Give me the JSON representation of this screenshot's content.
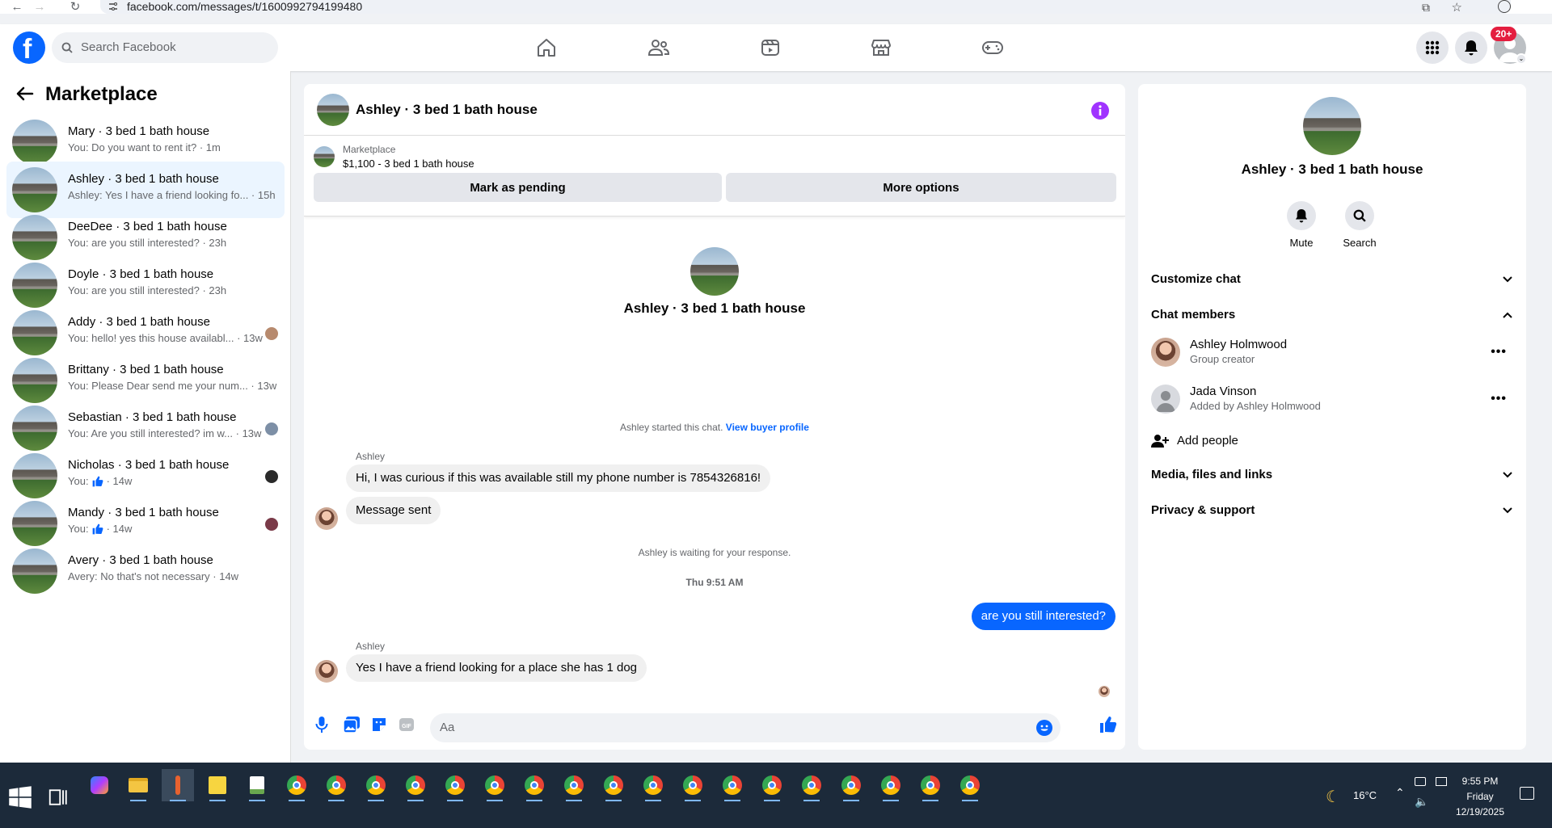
{
  "browser": {
    "url": "facebook.com/messages/t/1600992794199480"
  },
  "header": {
    "search_placeholder": "Search Facebook",
    "notifications_badge": "20+"
  },
  "sidebar": {
    "title": "Marketplace",
    "conversations": [
      {
        "name": "Mary · 3 bed 1 bath house",
        "preview": "You: Do you want to rent it? · 1m"
      },
      {
        "name": "Ashley · 3 bed 1 bath house",
        "preview": "Ashley: Yes I have a friend looking fo... · 15h"
      },
      {
        "name": "DeeDee · 3 bed 1 bath house",
        "preview": "You: are you still interested? · 23h"
      },
      {
        "name": "Doyle · 3 bed 1 bath house",
        "preview": "You: are you still interested? · 23h"
      },
      {
        "name": "Addy · 3 bed 1 bath house",
        "preview": "You: hello! yes this house availabl... · 13w"
      },
      {
        "name": "Brittany · 3 bed 1 bath house",
        "preview": "You: Please Dear send me your num... · 13w"
      },
      {
        "name": "Sebastian · 3 bed 1 bath house",
        "preview": "You: Are you still interested? im w... · 13w"
      },
      {
        "name": "Nicholas · 3 bed 1 bath house",
        "preview_prefix": "You:",
        "preview_suffix": "· 14w"
      },
      {
        "name": "Mandy · 3 bed 1 bath house",
        "preview_prefix": "You:",
        "preview_suffix": "· 14w"
      },
      {
        "name": "Avery · 3 bed 1 bath house",
        "preview": "Avery: No that's not necessary · 14w"
      }
    ]
  },
  "chat": {
    "title": "Ashley · 3 bed 1 bath house",
    "listing_label": "Marketplace",
    "listing_price": "$1,100 - 3 bed 1 bath house",
    "mark_pending": "Mark as pending",
    "more_options": "More options",
    "started_text": "Ashley started this chat.",
    "view_profile": "View buyer profile",
    "sender": "Ashley",
    "msg1": "Hi, I was curious if this was available still my phone number is 7854326816!",
    "msg2": "Message sent",
    "waiting": "Ashley is waiting for your response.",
    "time_divider": "Thu 9:51 AM",
    "my_msg": "are you still interested?",
    "msg3": "Yes I have a friend looking for a place she has 1 dog",
    "composer_placeholder": "Aa"
  },
  "info": {
    "name": "Ashley · 3 bed 1 bath house",
    "mute": "Mute",
    "search": "Search",
    "customize": "Customize chat",
    "members_title": "Chat members",
    "members": [
      {
        "name": "Ashley Holmwood",
        "role": "Group creator"
      },
      {
        "name": "Jada Vinson",
        "role": "Added by Ashley Holmwood"
      }
    ],
    "add_people": "Add people",
    "media": "Media, files and links",
    "privacy": "Privacy & support"
  },
  "taskbar": {
    "temperature": "16°C",
    "time": "9:55 PM",
    "day": "Friday",
    "date": "12/19/2025"
  },
  "colors": {
    "accent": "#0866ff",
    "info_icon": "#a033ff",
    "badge": "#e41e3f"
  }
}
